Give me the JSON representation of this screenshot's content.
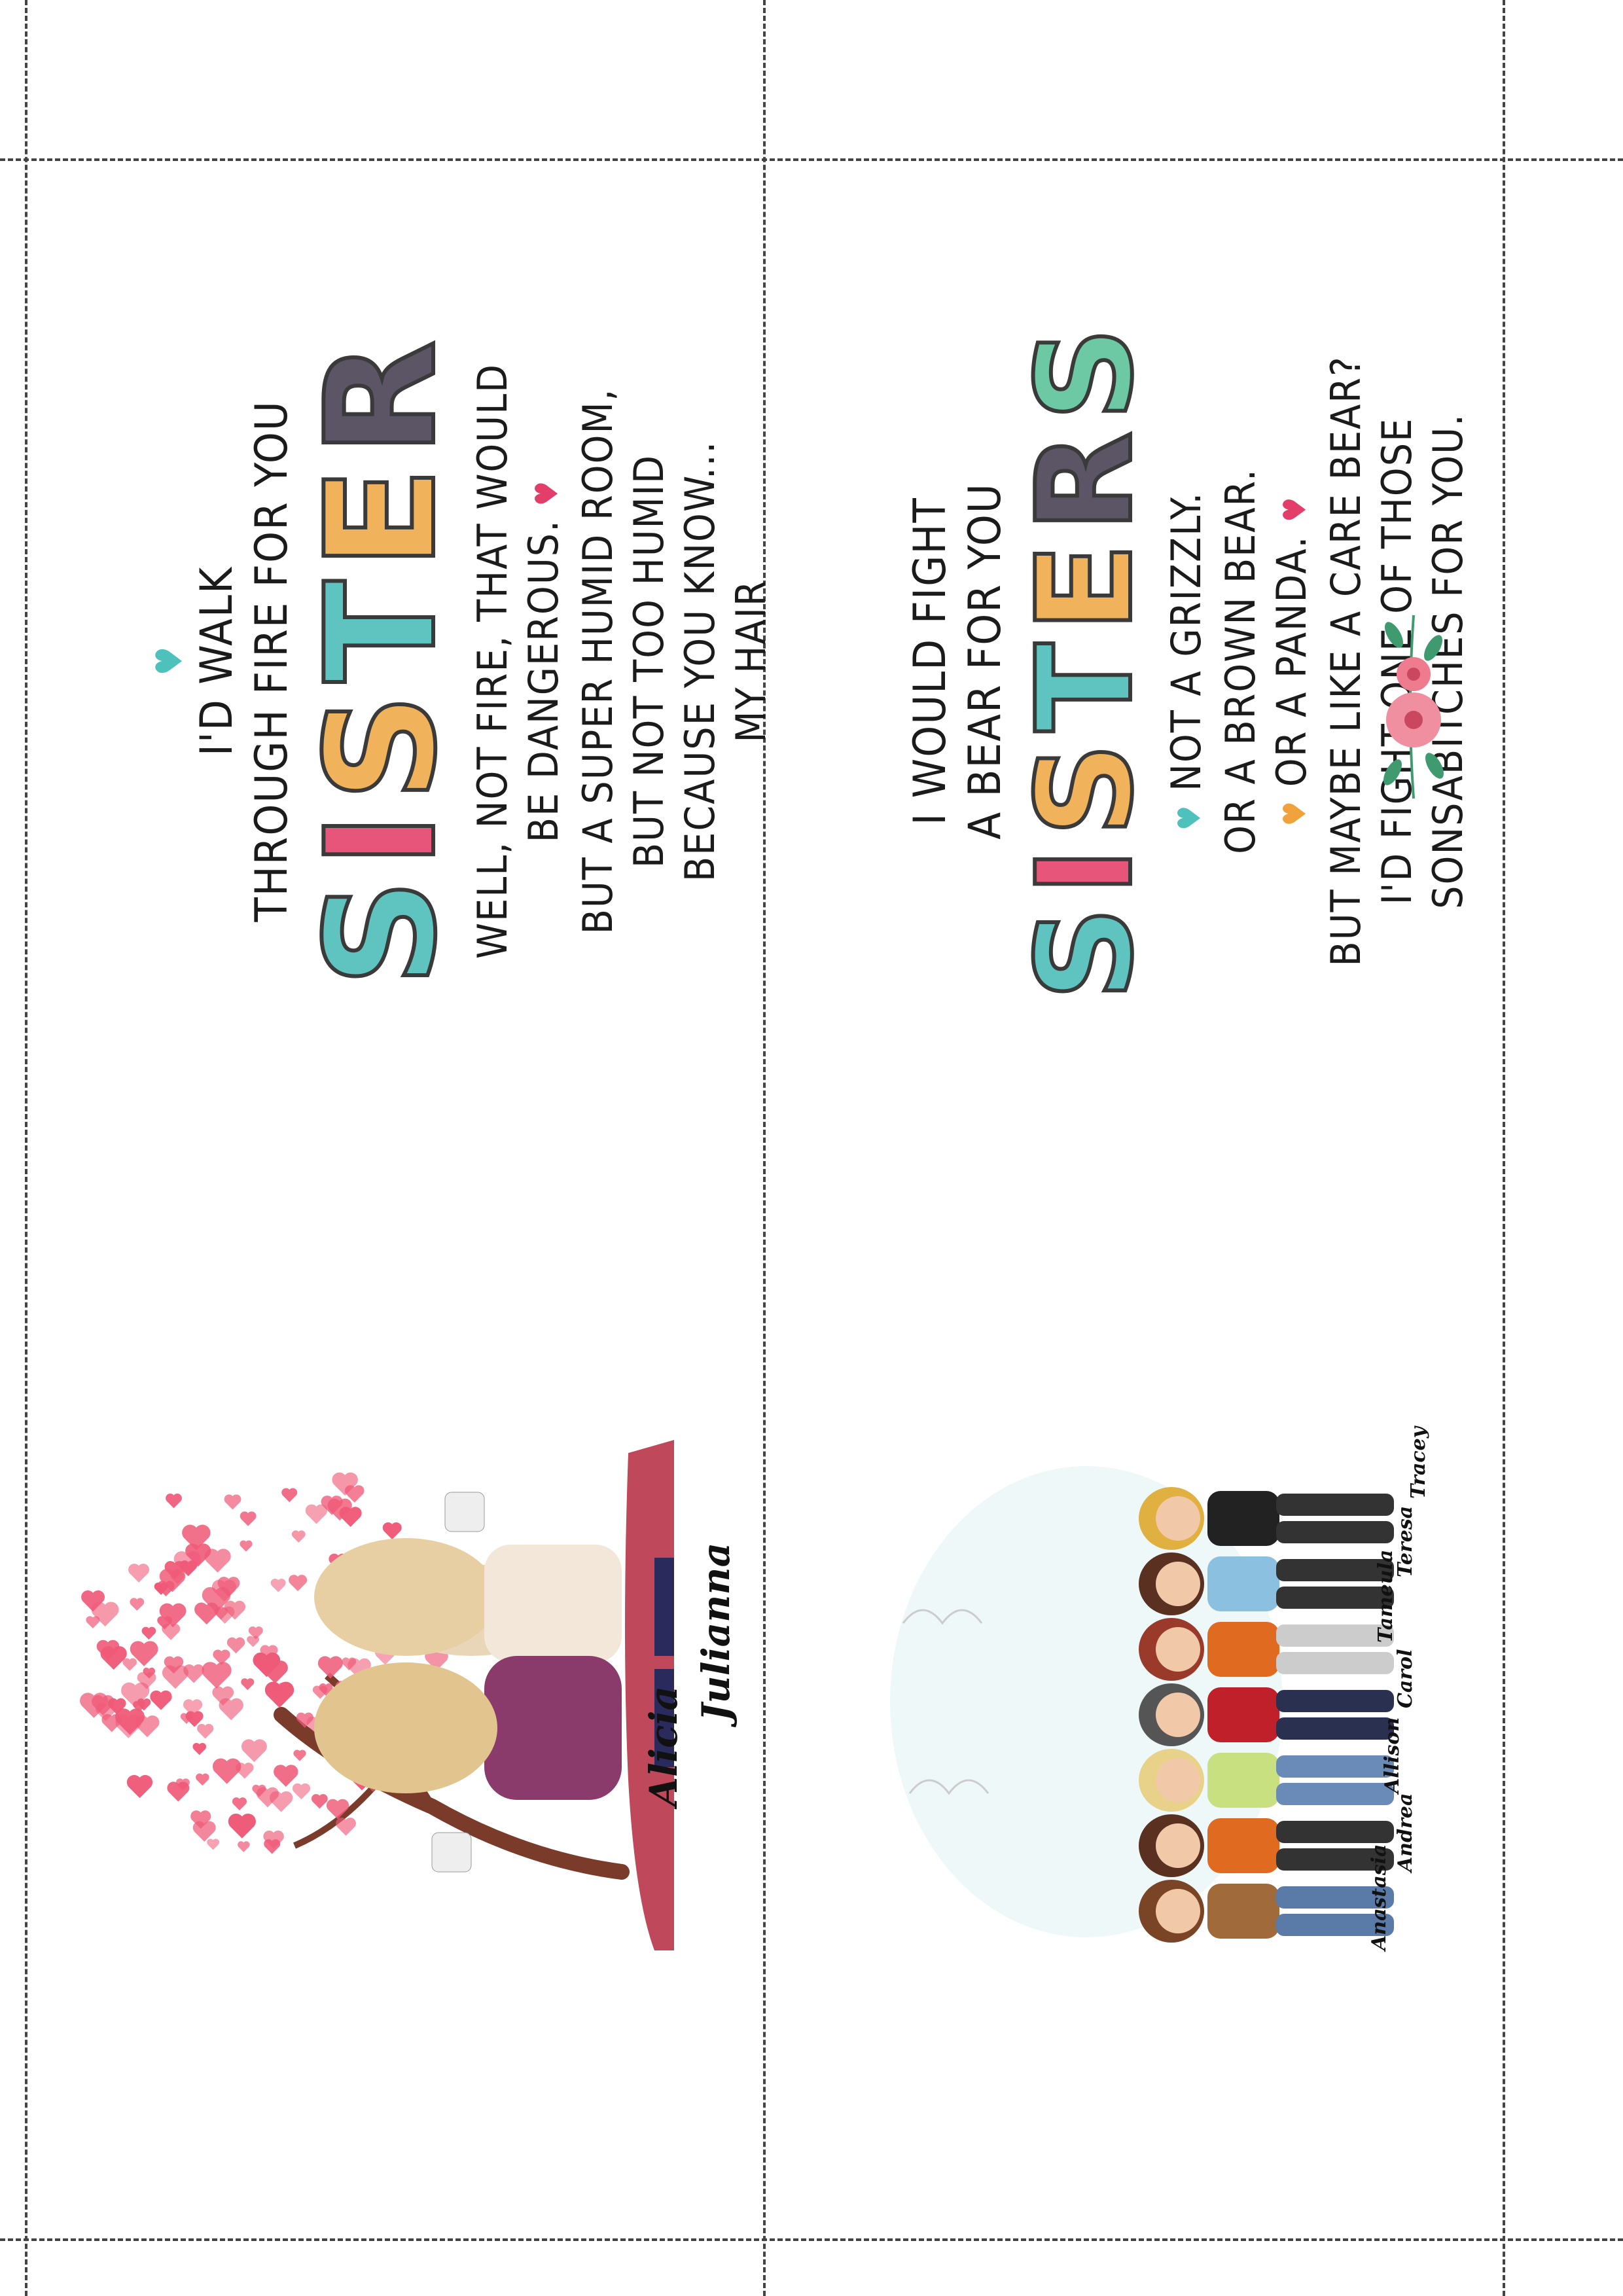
{
  "card1": {
    "heart_top": "♥",
    "lines_top": [
      "I'd walk",
      "through fire for you"
    ],
    "title_letters": [
      "S",
      "I",
      "S",
      "T",
      "E",
      "R"
    ],
    "title_colors": [
      "#5fc4c0",
      "#e8557a",
      "#f0b25a",
      "#5fc4c0",
      "#f0b25a",
      "#5b5566"
    ],
    "lines_body": [
      "Well, not fire, that would",
      "be dangerous.",
      "But a super humid room,",
      "but not too humid",
      "because you know...",
      "my hair"
    ],
    "heart_inline": "♥",
    "names": [
      "Alicia",
      "Julianna"
    ]
  },
  "card2": {
    "lines_top": [
      "I would fight",
      "a bear for you"
    ],
    "title_letters": [
      "S",
      "I",
      "S",
      "T",
      "E",
      "R",
      "S"
    ],
    "title_colors": [
      "#5fc4c0",
      "#e8557a",
      "#f0b25a",
      "#5fc4c0",
      "#f0b25a",
      "#5b5566",
      "#6cc9a3"
    ],
    "lines_body": [
      "Not a grizzly.",
      "Or a brown bear.",
      "Or a panda.",
      "But maybe like a care bear?",
      "I'd fight one of those",
      "sonsabitches for you."
    ],
    "hearts": [
      "♥",
      "♥",
      "♥"
    ],
    "names": [
      "Anastasia",
      "Andrea",
      "Allison",
      "Carol",
      "Tameula",
      "Teresa",
      "Tracey"
    ]
  },
  "colors": {
    "text": "#1b1b1b",
    "heart_teal": "#4fc1bd",
    "heart_pink": "#e33d6a",
    "heart_orange": "#f2a23a",
    "tree_pink": "#ef5a78",
    "flower_pink": "#ee7c8e",
    "leaf_green": "#3f9b6f"
  }
}
